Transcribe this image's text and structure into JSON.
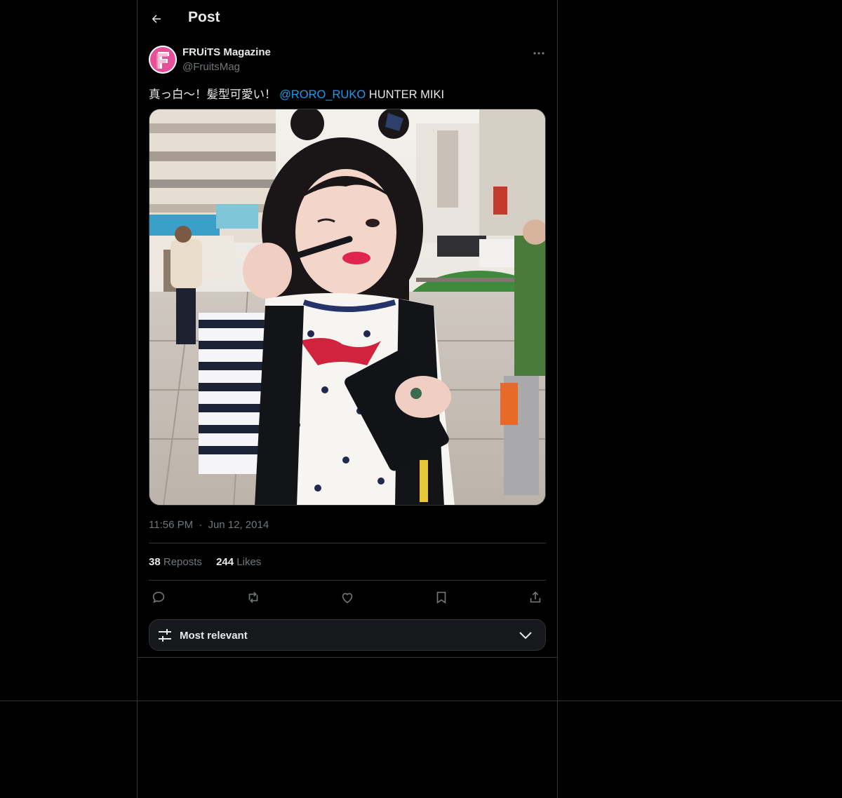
{
  "header": {
    "title": "Post",
    "back_icon": "arrow-left-icon"
  },
  "tweet": {
    "author_name": "FRUiTS Magazine",
    "author_handle": "@FruitsMag",
    "avatar_letter": "F",
    "text_before": "真っ白〜！髪型可愛い！ ",
    "mention": "@RORO_RUKO",
    "text_after": " HUNTER MIKI",
    "time": "11:56 PM",
    "separator": "·",
    "date": "Jun 12, 2014",
    "reposts_count": "38",
    "reposts_label": "Reposts",
    "likes_count": "244",
    "likes_label": "Likes"
  },
  "actions": [
    "reply-icon",
    "repost-icon",
    "like-icon",
    "bookmark-icon",
    "share-icon"
  ],
  "sort": {
    "label": "Most relevant"
  },
  "colors": {
    "background": "#000000",
    "border": "#2f3336",
    "text": "#e7e9ea",
    "muted": "#71767b",
    "accent": "#1d9bf0",
    "avatar_pink": "#e84f9b"
  }
}
